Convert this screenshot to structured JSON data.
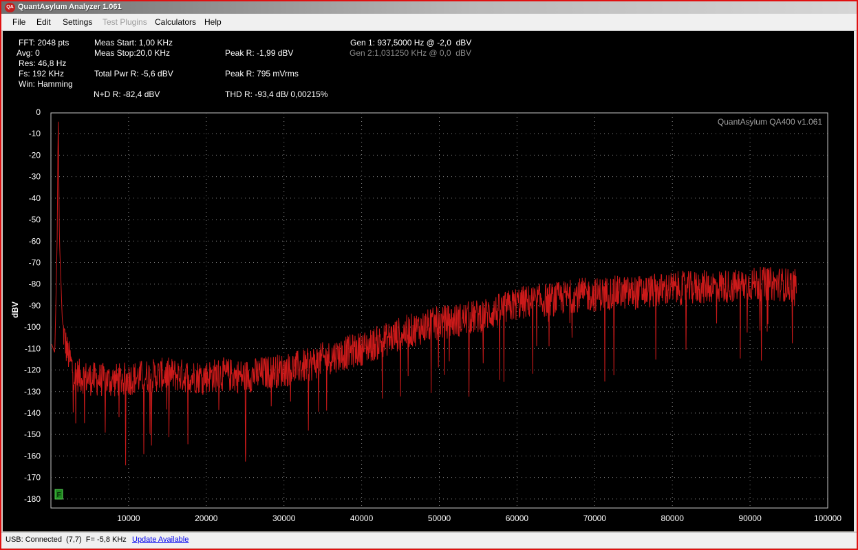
{
  "window": {
    "title": "QuantAsylum Analyzer 1.061",
    "app_icon_text": "QA"
  },
  "menu": [
    "File",
    "Edit",
    "Settings",
    "Test Plugins",
    "Calculators",
    "Help"
  ],
  "menu_disabled": [
    "Test Plugins"
  ],
  "info": {
    "fft": "FFT: 2048 pts",
    "avg": "Avg: 0",
    "res": "Res: 46,8 Hz",
    "fs": "Fs: 192 KHz",
    "win": "Win: Hamming",
    "meas_start": "Meas Start: 1,00 KHz",
    "meas_stop": "Meas Stop:20,0 KHz",
    "total_pwr": "Total Pwr R: -5,6 dBV",
    "nd": "N+D R: -82,4 dBV",
    "peak_dbv": "Peak R: -1,99 dBV",
    "peak_vrms": "Peak R: 795 mVrms",
    "thd": "THD R: -93,4 dB/ 0,00215%",
    "gen1": "Gen 1: 937,5000 Hz @ -2,0  dBV",
    "gen2": "Gen 2:1,031250 KHz @ 0,0  dBV"
  },
  "status": {
    "usb": "USB: Connected  (7,7)  F= -5,8 KHz",
    "update": "Update Available"
  },
  "chart_data": {
    "type": "line",
    "watermark": "QuantAsylum QA400 v1.061",
    "ylabel": "dBV",
    "xlabel": "",
    "xlim": [
      0,
      100000
    ],
    "ylim": [
      -185,
      0
    ],
    "x_ticks": [
      10000,
      20000,
      30000,
      40000,
      50000,
      60000,
      70000,
      80000,
      90000,
      100000
    ],
    "y_ticks": [
      0,
      -10,
      -20,
      -30,
      -40,
      -50,
      -60,
      -70,
      -80,
      -90,
      -100,
      -110,
      -120,
      -130,
      -140,
      -150,
      -160,
      -170,
      -180
    ],
    "grid": true,
    "marker_label": "F",
    "series": [
      {
        "color": "#cc1a1a",
        "x": [
          100,
          500,
          800,
          937,
          1100,
          1500,
          2000,
          3000,
          5000,
          8000,
          10000,
          12000,
          15000,
          18000,
          20000,
          22000,
          25000,
          28000,
          30000,
          33000,
          35000,
          38000,
          40000,
          43000,
          45000,
          48000,
          50000,
          52000,
          55000,
          58000,
          60000,
          62000,
          65000,
          68000,
          70000,
          72000,
          75000,
          78000,
          80000,
          82000,
          85000,
          88000,
          90000,
          92000,
          94000,
          96000
        ],
        "y": [
          -108,
          -112,
          -60,
          -2,
          -60,
          -100,
          -110,
          -122,
          -124,
          -125,
          -124,
          -123,
          -122,
          -123,
          -123,
          -122,
          -123,
          -121,
          -120,
          -118,
          -115,
          -112,
          -110,
          -106,
          -103,
          -100,
          -98,
          -97,
          -95,
          -92,
          -89,
          -88,
          -87,
          -85,
          -85,
          -84,
          -84,
          -83,
          -82,
          -82,
          -81,
          -81,
          -80,
          -80,
          -80,
          -81
        ]
      }
    ]
  }
}
